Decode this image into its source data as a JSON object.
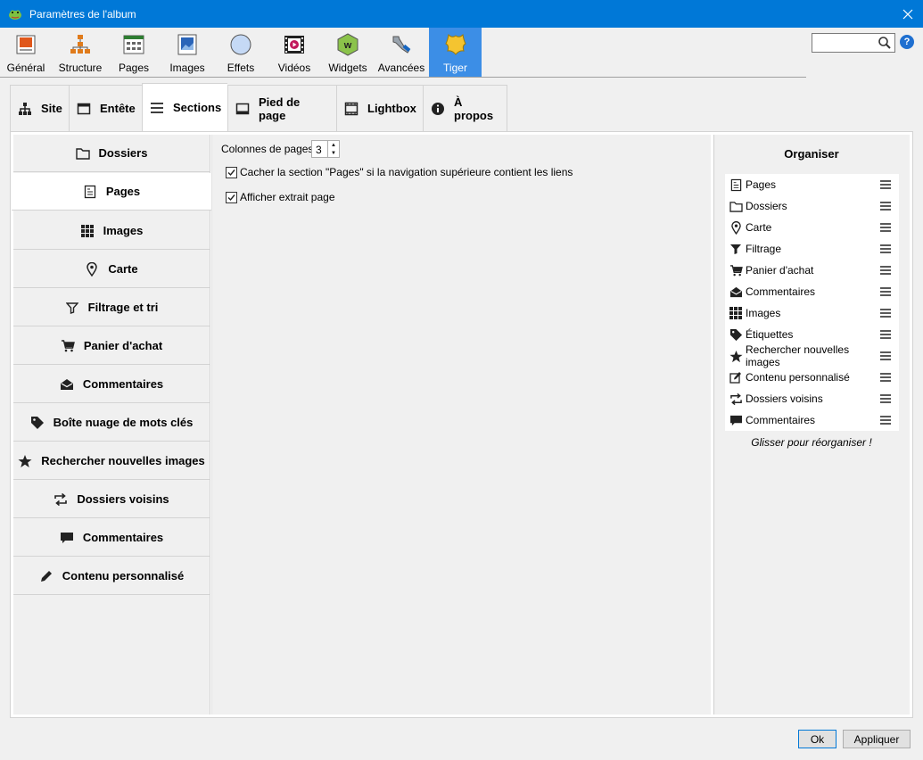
{
  "window": {
    "title": "Paramètres de l'album"
  },
  "toolbar": {
    "items": [
      {
        "label": "Général",
        "icon": "general-icon"
      },
      {
        "label": "Structure",
        "icon": "structure-icon"
      },
      {
        "label": "Pages",
        "icon": "pages-icon"
      },
      {
        "label": "Images",
        "icon": "images-icon"
      },
      {
        "label": "Effets",
        "icon": "effects-icon"
      },
      {
        "label": "Vidéos",
        "icon": "video-icon"
      },
      {
        "label": "Widgets",
        "icon": "widgets-icon"
      },
      {
        "label": "Avancées",
        "icon": "advanced-icon"
      },
      {
        "label": "Tiger",
        "icon": "tiger-icon"
      }
    ],
    "active": "Tiger",
    "search_value": ""
  },
  "tabs": [
    {
      "label": "Site",
      "icon": "sitemap-icon"
    },
    {
      "label": "Entête",
      "icon": "header-icon"
    },
    {
      "label": "Sections",
      "icon": "list-icon"
    },
    {
      "label": "Pied de page",
      "icon": "footer-icon"
    },
    {
      "label": "Lightbox",
      "icon": "lightbox-icon"
    },
    {
      "label": "À propos",
      "icon": "info-icon"
    }
  ],
  "active_tab": "Sections",
  "sections": [
    {
      "label": "Dossiers",
      "icon": "folder-icon"
    },
    {
      "label": "Pages",
      "icon": "page-icon"
    },
    {
      "label": "Images",
      "icon": "grid-icon"
    },
    {
      "label": "Carte",
      "icon": "map-marker-icon"
    },
    {
      "label": "Filtrage et tri",
      "icon": "filter-icon"
    },
    {
      "label": "Panier d'achat",
      "icon": "cart-icon"
    },
    {
      "label": "Commentaires",
      "icon": "envelope-icon"
    },
    {
      "label": "Boîte nuage de mots clés",
      "icon": "tag-icon"
    },
    {
      "label": "Rechercher nouvelles images",
      "icon": "star-icon"
    },
    {
      "label": "Dossiers voisins",
      "icon": "swap-icon"
    },
    {
      "label": "Commentaires",
      "icon": "comment-icon"
    },
    {
      "label": "Contenu personnalisé",
      "icon": "pencil-icon"
    }
  ],
  "active_section": "Pages",
  "pages_settings": {
    "columns_label": "Colonnes de pages",
    "columns_value": "3",
    "hide_section_label": "Cacher la section \"Pages\" si la navigation supérieure contient les liens",
    "hide_section_checked": true,
    "show_excerpt_label": "Afficher extrait page",
    "show_excerpt_checked": true
  },
  "organize": {
    "title": "Organiser",
    "items": [
      {
        "label": "Pages",
        "icon": "page-icon"
      },
      {
        "label": "Dossiers",
        "icon": "folder-icon"
      },
      {
        "label": "Carte",
        "icon": "map-marker-icon"
      },
      {
        "label": "Filtrage",
        "icon": "filter-icon"
      },
      {
        "label": "Panier d'achat",
        "icon": "cart-icon"
      },
      {
        "label": "Commentaires",
        "icon": "envelope-icon"
      },
      {
        "label": "Images",
        "icon": "grid-icon"
      },
      {
        "label": "Étiquettes",
        "icon": "tag-icon"
      },
      {
        "label": "Rechercher nouvelles images",
        "icon": "star-icon"
      },
      {
        "label": "Contenu personnalisé",
        "icon": "edit-icon"
      },
      {
        "label": "Dossiers voisins",
        "icon": "swap-icon"
      },
      {
        "label": "Commentaires",
        "icon": "comment-icon"
      }
    ],
    "hint": "Glisser pour réorganiser !"
  },
  "buttons": {
    "ok": "Ok",
    "apply": "Appliquer"
  },
  "colors": {
    "titlebar": "#0078d7",
    "active_toolbar": "#3c8ee6",
    "background": "#f0f0f0"
  }
}
